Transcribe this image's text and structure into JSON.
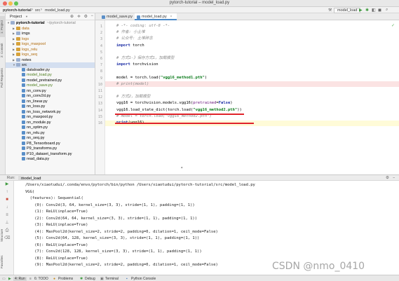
{
  "window": {
    "title": "pytorch-tutorial – model_load.py",
    "traffic_lights": [
      "#ee6a5f",
      "#f5be4f",
      "#62c554"
    ]
  },
  "navbar": {
    "breadcrumbs": [
      "pytorch-tutorial",
      "src",
      "model_load.py"
    ],
    "run_config": "model_load"
  },
  "left_tabs": [
    "1: Project",
    "2: Commit",
    "Pull Requests"
  ],
  "project": {
    "header": "Project",
    "tree": [
      {
        "label": "pytorch-tutorial",
        "suffix": "~/pytorch-tutorial",
        "type": "folder",
        "depth": 0,
        "open": true
      },
      {
        "label": "data",
        "type": "folder",
        "depth": 1,
        "color": "orange"
      },
      {
        "label": "imgs",
        "type": "folder",
        "depth": 1
      },
      {
        "label": "logs",
        "type": "folder",
        "depth": 1,
        "color": "orange"
      },
      {
        "label": "logs_maxpool",
        "type": "folder",
        "depth": 1,
        "color": "orange"
      },
      {
        "label": "logs_relu",
        "type": "folder",
        "depth": 1,
        "color": "orange"
      },
      {
        "label": "logs_seq",
        "type": "folder",
        "depth": 1,
        "color": "orange"
      },
      {
        "label": "notes",
        "type": "folder",
        "depth": 1
      },
      {
        "label": "src",
        "type": "folder",
        "depth": 1,
        "open": true,
        "selected": true
      },
      {
        "label": "dataloader.py",
        "type": "file",
        "depth": 2
      },
      {
        "label": "model_load.py",
        "type": "file",
        "depth": 2,
        "color": "green"
      },
      {
        "label": "model_pretrained.py",
        "type": "file",
        "depth": 2
      },
      {
        "label": "model_save.py",
        "type": "file",
        "depth": 2,
        "color": "green"
      },
      {
        "label": "nn_conv.py",
        "type": "file",
        "depth": 2
      },
      {
        "label": "nn_conv2d.py",
        "type": "file",
        "depth": 2
      },
      {
        "label": "nn_linear.py",
        "type": "file",
        "depth": 2
      },
      {
        "label": "nn_loss.py",
        "type": "file",
        "depth": 2
      },
      {
        "label": "nn_loss_network.py",
        "type": "file",
        "depth": 2
      },
      {
        "label": "nn_maxpool.py",
        "type": "file",
        "depth": 2
      },
      {
        "label": "nn_module.py",
        "type": "file",
        "depth": 2
      },
      {
        "label": "nn_optim.py",
        "type": "file",
        "depth": 2
      },
      {
        "label": "nn_relu.py",
        "type": "file",
        "depth": 2
      },
      {
        "label": "nn_seq.py",
        "type": "file",
        "depth": 2
      },
      {
        "label": "P8_Tensorboard.py",
        "type": "file",
        "depth": 2
      },
      {
        "label": "P9_transforms.py",
        "type": "file",
        "depth": 2
      },
      {
        "label": "P10_dataset_transform.py",
        "type": "file",
        "depth": 2
      },
      {
        "label": "read_data.py",
        "type": "file",
        "depth": 2
      }
    ]
  },
  "tabs": [
    {
      "label": "model_save.py",
      "active": false
    },
    {
      "label": "model_load.py",
      "active": true
    }
  ],
  "editor": {
    "lines": [
      {
        "n": "1",
        "parts": [
          {
            "t": "# -*- coding: utf-8 -*-",
            "c": "comment"
          }
        ]
      },
      {
        "n": "2",
        "parts": [
          {
            "t": "# 作者: 小土堆",
            "c": "comment"
          }
        ]
      },
      {
        "n": "3",
        "parts": [
          {
            "t": "# 公众号: 土堆碎念",
            "c": "comment"
          }
        ]
      },
      {
        "n": "4",
        "parts": [
          {
            "t": "import ",
            "c": "kw"
          },
          {
            "t": "torch",
            "c": "name"
          }
        ]
      },
      {
        "n": "5",
        "parts": []
      },
      {
        "n": "6",
        "parts": [
          {
            "t": "# 方式1-》保存方式1，加载模型",
            "c": "comment"
          }
        ]
      },
      {
        "n": "7",
        "parts": [
          {
            "t": "import ",
            "c": "kw"
          },
          {
            "t": "torchvision",
            "c": "name"
          }
        ]
      },
      {
        "n": "8",
        "parts": []
      },
      {
        "n": "9",
        "parts": [
          {
            "t": "model = torch.load(",
            "c": "name"
          },
          {
            "t": "\"vgg16_method1.pth\"",
            "c": "str"
          },
          {
            "t": ")",
            "c": "name"
          }
        ]
      },
      {
        "n": "10",
        "parts": [
          {
            "t": "# print(model)",
            "c": "comment"
          }
        ],
        "bg": "err"
      },
      {
        "n": "11",
        "parts": []
      },
      {
        "n": "12",
        "parts": [
          {
            "t": "# 方式2，加载模型",
            "c": "comment"
          }
        ]
      },
      {
        "n": "13",
        "parts": [
          {
            "t": "vgg16 = torchvision.models.vgg16(",
            "c": "name"
          },
          {
            "t": "pretrained",
            "c": "param"
          },
          {
            "t": "=",
            "c": "name"
          },
          {
            "t": "False",
            "c": "kw"
          },
          {
            "t": ")",
            "c": "name"
          }
        ]
      },
      {
        "n": "14",
        "parts": [
          {
            "t": "vgg16.load_state_dict(torch.load(",
            "c": "name"
          },
          {
            "t": "\"vgg16_method2.pth\"",
            "c": "str"
          },
          {
            "t": "))",
            "c": "name"
          }
        ]
      },
      {
        "n": "15",
        "parts": [
          {
            "t": "# model = torch.load(\"vgg16_method2.pth\")",
            "c": "comment"
          }
        ]
      },
      {
        "n": "16",
        "parts": [
          {
            "t": "print",
            "c": "kw"
          },
          {
            "t": "(vgg16)",
            "c": "name"
          }
        ],
        "bg": "cur"
      }
    ]
  },
  "run": {
    "tab_label": "Run:",
    "config": "model_load",
    "output": [
      "/Users/xiaotudui/.conda/envs/pytorch/bin/python /Users/xiaotudui/pytorch-tutorial/src/model_load.py",
      "VGG(",
      "  (features): Sequential(",
      "    (0): Conv2d(3, 64, kernel_size=(3, 3), stride=(1, 1), padding=(1, 1))",
      "    (1): ReLU(inplace=True)",
      "    (2): Conv2d(64, 64, kernel_size=(3, 3), stride=(1, 1), padding=(1, 1))",
      "    (3): ReLU(inplace=True)",
      "    (4): MaxPool2d(kernel_size=2, stride=2, padding=0, dilation=1, ceil_mode=False)",
      "    (5): Conv2d(64, 128, kernel_size=(3, 3), stride=(1, 1), padding=(1, 1))",
      "    (6): ReLU(inplace=True)",
      "    (7): Conv2d(128, 128, kernel_size=(3, 3), stride=(1, 1), padding=(1, 1))",
      "    (8): ReLU(inplace=True)",
      "    (9): MaxPool2d(kernel_size=2, stride=2, padding=0, dilation=1, ceil_mode=False)"
    ],
    "side_tabs": [
      "Structure",
      "Favorites"
    ]
  },
  "statusbar": {
    "items": [
      "4: Run",
      "6: TODO",
      "Problems",
      "Debug",
      "Terminal",
      "Python Console"
    ]
  },
  "watermark": "CSDN @nmo_0410"
}
